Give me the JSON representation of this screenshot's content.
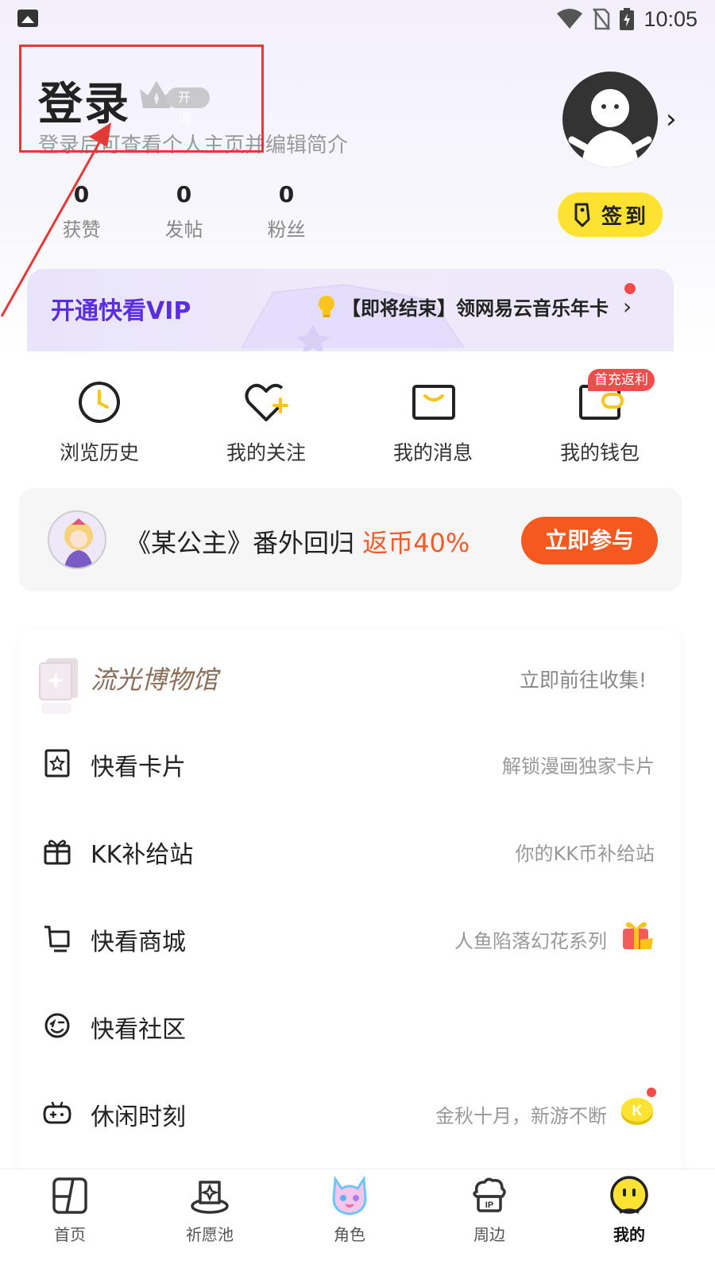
{
  "status_bar": {
    "time": "10:05"
  },
  "profile": {
    "title": "登录",
    "vip_badge": "开通",
    "subtitle": "登录后可查看个人主页并编辑简介",
    "stats": [
      {
        "value": "0",
        "label": "获赞"
      },
      {
        "value": "0",
        "label": "发帖"
      },
      {
        "value": "0",
        "label": "粉丝"
      }
    ],
    "checkin_label": "签到"
  },
  "vip": {
    "title": "开通快看VIP",
    "promo": "【即将结束】领网易云音乐年卡"
  },
  "quick_actions": [
    {
      "label": "浏览历史",
      "icon": "clock-icon"
    },
    {
      "label": "我的关注",
      "icon": "heart-plus-icon"
    },
    {
      "label": "我的消息",
      "icon": "message-icon"
    },
    {
      "label": "我的钱包",
      "icon": "wallet-icon"
    }
  ],
  "wallet_badge": "首充返利",
  "promo_banner": {
    "text": "《某公主》番外回归",
    "highlight": "返币40%",
    "button": "立即参与"
  },
  "museum": {
    "title": "流光博物馆",
    "link": "立即前往收集!"
  },
  "menu": [
    {
      "label": "快看卡片",
      "hint": "解锁漫画独家卡片",
      "icon": "card-icon"
    },
    {
      "label": "KK补给站",
      "hint": "你的KK币补给站",
      "icon": "gift-box-icon"
    },
    {
      "label": "快看商城",
      "hint": "人鱼陷落幻花系列",
      "icon": "cart-icon"
    },
    {
      "label": "快看社区",
      "hint": "",
      "icon": "community-icon"
    },
    {
      "label": "休闲时刻",
      "hint": "金秋十月，新游不断",
      "icon": "gamepad-icon"
    }
  ],
  "tabs": [
    {
      "label": "首页",
      "icon": "home-icon"
    },
    {
      "label": "祈愿池",
      "icon": "wish-icon"
    },
    {
      "label": "角色",
      "icon": "character-icon"
    },
    {
      "label": "周边",
      "icon": "merch-icon"
    },
    {
      "label": "我的",
      "icon": "me-icon"
    }
  ],
  "colors": {
    "vip_title": "#5a2de0",
    "checkin_bg": "#fde232",
    "promo_button": "#f6591f",
    "promo_highlight": "#f45b2b",
    "annotation": "#e53935"
  }
}
